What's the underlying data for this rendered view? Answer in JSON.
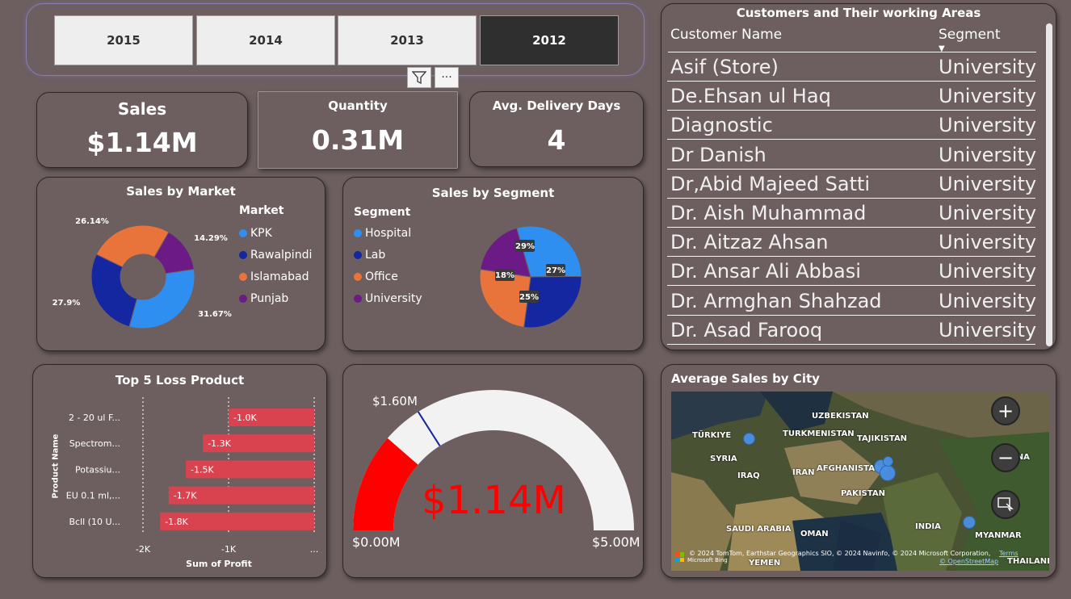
{
  "slicer": {
    "years": [
      {
        "label": "2015",
        "selected": false
      },
      {
        "label": "2014",
        "selected": false
      },
      {
        "label": "2013",
        "selected": false
      },
      {
        "label": "2012",
        "selected": true
      }
    ],
    "more_label": "···"
  },
  "kpis": {
    "sales": {
      "title": "Sales",
      "value": "$1.14M"
    },
    "quantity": {
      "title": "Quantity",
      "value": "0.31M"
    },
    "delivery": {
      "title": "Avg. Delivery Days",
      "value": "4"
    }
  },
  "market_chart": {
    "title": "Sales by Market",
    "legend_title": "Market",
    "slices": [
      {
        "name": "KPK",
        "value": 31.67,
        "label": "31.67%",
        "color": "#2f8ff0"
      },
      {
        "name": "Rawalpindi",
        "value": 27.9,
        "label": "27.9%",
        "color": "#1426a0"
      },
      {
        "name": "Islamabad",
        "value": 26.14,
        "label": "26.14%",
        "color": "#e8743b"
      },
      {
        "name": "Punjab",
        "value": 14.29,
        "label": "14.29%",
        "color": "#6b1a86"
      }
    ]
  },
  "segment_chart": {
    "title": "Sales by Segment",
    "legend_title": "Segment",
    "slices": [
      {
        "name": "Hospital",
        "value": 29,
        "label": "29%",
        "color": "#2f8ff0"
      },
      {
        "name": "Lab",
        "value": 27,
        "label": "27%",
        "color": "#1426a0"
      },
      {
        "name": "Office",
        "value": 25,
        "label": "25%",
        "color": "#e8743b"
      },
      {
        "name": "University",
        "value": 18,
        "label": "18%",
        "color": "#6b1a86"
      }
    ]
  },
  "customers": {
    "title": "Customers and Their working Areas",
    "col_name": "Customer Name",
    "col_segment": "Segment",
    "rows": [
      {
        "name": "Asif (Store)",
        "segment": "University"
      },
      {
        "name": "De.Ehsan ul Haq",
        "segment": "University"
      },
      {
        "name": "Diagnostic",
        "segment": "University"
      },
      {
        "name": "Dr Danish",
        "segment": "University"
      },
      {
        "name": "Dr,Abid Majeed Satti",
        "segment": "University"
      },
      {
        "name": "Dr. Aish Muhammad",
        "segment": "University"
      },
      {
        "name": "Dr. Aitzaz Ahsan",
        "segment": "University"
      },
      {
        "name": "Dr. Ansar Ali Abbasi",
        "segment": "University"
      },
      {
        "name": "Dr. Armghan Shahzad",
        "segment": "University"
      },
      {
        "name": "Dr. Asad Farooq",
        "segment": "University"
      }
    ]
  },
  "chart_data": [
    {
      "type": "bar",
      "title": "Top 5 Loss Product",
      "xlabel": "Sum of Profit",
      "ylabel": "Product Name",
      "categories": [
        "2 - 20 ul F...",
        "Spectrom...",
        "Potassiu...",
        "EU 0.1 ml,...",
        "Bcll (10 U..."
      ],
      "values": [
        -1.0,
        -1.3,
        -1.5,
        -1.7,
        -1.8
      ],
      "data_labels": [
        "-1.0K",
        "-1.3K",
        "-1.5K",
        "-1.7K",
        "-1.8K"
      ],
      "xticks": [
        "-2K",
        "-1K",
        "..."
      ],
      "xlim": [
        -2.0,
        0.0
      ],
      "color": "#d9434f"
    },
    {
      "type": "gauge",
      "value": 1.14,
      "value_label": "$1.14M",
      "min": 0,
      "min_label": "$0.00M",
      "max": 5.0,
      "max_label": "$5.00M",
      "target": 1.6,
      "target_label": "$1.60M",
      "fill_color": "#ff0000",
      "track_color": "#f2f2f2"
    }
  ],
  "map": {
    "title": "Average Sales by City",
    "labels": [
      {
        "text": "UZBEKISTAN"
      },
      {
        "text": "TÜRKIYE"
      },
      {
        "text": "TURKMENISTAN"
      },
      {
        "text": "TAJIKISTAN"
      },
      {
        "text": "SYRIA"
      },
      {
        "text": "AFGHANISTAN"
      },
      {
        "text": "IRAQ"
      },
      {
        "text": "IRAN"
      },
      {
        "text": "PAKISTAN"
      },
      {
        "text": "INDIA"
      },
      {
        "text": "SAUDI ARABIA"
      },
      {
        "text": "OMAN"
      },
      {
        "text": "MYANMAR"
      },
      {
        "text": "YEMEN"
      },
      {
        "text": "THAILAND"
      },
      {
        "text": "INA"
      }
    ],
    "attribution": "© 2024 TomTom, Earthstar Geographics SIO, © 2024 Navinfo, © 2024 Microsoft Corporation,",
    "terms": "Terms",
    "osm": "© OpenStreetMap",
    "bing": "Microsoft Bing",
    "zoom_in": "+",
    "zoom_out": "−"
  }
}
